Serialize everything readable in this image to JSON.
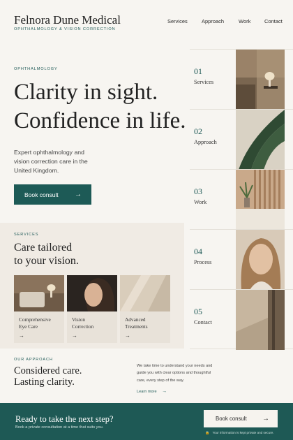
{
  "header": {
    "brand": "Felnora Dune Medical",
    "tagline": "OPHTHALMOLOGY & VISION CORRECTION",
    "nav": [
      "Services",
      "Approach",
      "Work",
      "Contact"
    ]
  },
  "hero": {
    "eyebrow": "OPHTHALMOLOGY",
    "title_line1": "Clarity in sight.",
    "title_line2": "Confidence in life.",
    "subtitle": "Expert ophthalmology and vision correction care in the United Kingdom.",
    "button_label": "Book consult",
    "button_icon": "arrow-right-icon"
  },
  "right_nav": [
    {
      "num": "01",
      "label": "Services"
    },
    {
      "num": "02",
      "label": "Approach"
    },
    {
      "num": "03",
      "label": "Work"
    },
    {
      "num": "04",
      "label": "Process"
    },
    {
      "num": "05",
      "label": "Contact"
    }
  ],
  "services": {
    "eyebrow": "SERVICES",
    "title_line1": "Care tailored",
    "title_line2": "to your vision.",
    "cards": [
      {
        "line1": "Comprehensive",
        "line2": "Eye Care"
      },
      {
        "line1": "Vision",
        "line2": "Correction"
      },
      {
        "line1": "Advanced",
        "line2": "Treatments"
      }
    ]
  },
  "approach": {
    "eyebrow": "OUR APPROACH",
    "title_line1": "Considered care.",
    "title_line2": "Lasting clarity.",
    "text": "We take time to understand your needs and guide you with clear options and thoughtful care, every step of the way.",
    "link": "Learn more"
  },
  "cta": {
    "title": "Ready to take the next step?",
    "subtitle": "Book a private consultation at a time that suits you.",
    "button_label": "Book consult",
    "secure_text": "Your information is kept private and secure."
  },
  "colors": {
    "accent": "#1d5a56",
    "background": "#f7f5f1",
    "panel": "#f0ebe4"
  }
}
